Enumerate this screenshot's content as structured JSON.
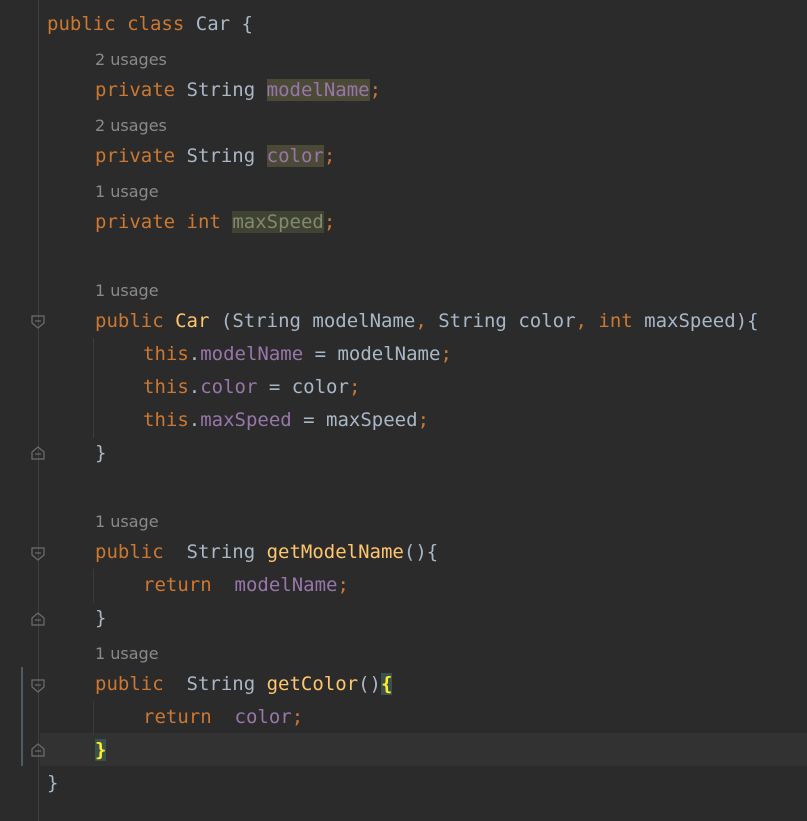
{
  "code": {
    "class_decl": {
      "kw_public": "public",
      "kw_class": "class",
      "name": "Car",
      "brace": "{"
    },
    "field1": {
      "hint": "2 usages",
      "kw": "private",
      "type": "String",
      "name": "modelName",
      "semi": ";"
    },
    "field2": {
      "hint": "2 usages",
      "kw": "private",
      "type": "String",
      "name": "color",
      "semi": ";"
    },
    "field3": {
      "hint": "1 usage",
      "kw": "private",
      "type": "int",
      "name": "maxSpeed",
      "semi": ";"
    },
    "ctor": {
      "hint": "1 usage",
      "kw": "public",
      "name": "Car",
      "open": " (",
      "p1_type": "String",
      "p1_name": " modelName",
      "comma1": ",",
      "p2_type": " String",
      "p2_name": " color",
      "comma2": ",",
      "p3_type": " int",
      "p3_name": " maxSpeed",
      "close": "){",
      "body": [
        {
          "this": "this",
          "dot": ".",
          "field": "modelName",
          "rest": " = modelName",
          "semi": ";"
        },
        {
          "this": "this",
          "dot": ".",
          "field": "color",
          "rest": " = color",
          "semi": ";"
        },
        {
          "this": "this",
          "dot": ".",
          "field": "maxSpeed",
          "rest": " = maxSpeed",
          "semi": ";"
        }
      ],
      "end": "}"
    },
    "method1": {
      "hint": "1 usage",
      "kw": "public",
      "type": "  String ",
      "name": "getModelName",
      "sig": "(){",
      "ret": "return",
      "ret_val": "modelName",
      "semi": ";",
      "end": "}"
    },
    "method2": {
      "hint": "1 usage",
      "kw": "public",
      "type": "  String ",
      "name": "getColor",
      "sig": "()",
      "brace": "{",
      "ret": "return",
      "ret_val": "color",
      "semi": ";",
      "end": "}"
    },
    "class_end": "}"
  },
  "colors": {
    "background": "#2b2b2b",
    "keyword": "#cc7832",
    "field": "#9876aa",
    "method": "#ffc66d",
    "text": "#a9b7c6",
    "hint": "#8a8a8a"
  }
}
